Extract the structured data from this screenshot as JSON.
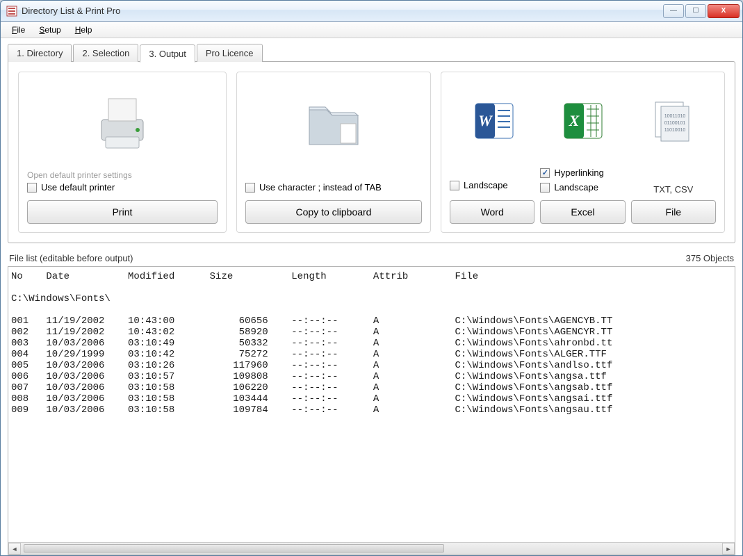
{
  "window": {
    "title": "Directory List & Print Pro"
  },
  "menu": {
    "file": "File",
    "setup": "Setup",
    "help": "Help"
  },
  "tabs": {
    "directory": "1. Directory",
    "selection": "2. Selection",
    "output": "3. Output",
    "licence": "Pro Licence",
    "active": "output"
  },
  "print_panel": {
    "open_settings": "Open default printer settings",
    "use_default": "Use default printer",
    "use_default_checked": false,
    "button": "Print"
  },
  "clipboard_panel": {
    "use_semicolon": "Use character ; instead of TAB",
    "use_semicolon_checked": false,
    "button": "Copy to clipboard"
  },
  "export_panel": {
    "word": {
      "landscape": "Landscape",
      "landscape_checked": false,
      "button": "Word"
    },
    "excel": {
      "hyperlinking": "Hyperlinking",
      "hyperlinking_checked": true,
      "landscape": "Landscape",
      "landscape_checked": false,
      "button": "Excel"
    },
    "file": {
      "formats": "TXT, CSV",
      "button": "File"
    }
  },
  "filelist": {
    "label": "File list (editable before output)",
    "count_label": "375 Objects",
    "headers": {
      "no": "No",
      "date": "Date",
      "modified": "Modified",
      "size": "Size",
      "length": "Length",
      "attrib": "Attrib",
      "file": "File"
    },
    "root": "C:\\Windows\\Fonts\\",
    "rows": [
      {
        "no": "001",
        "date": "11/19/2002",
        "modified": "10:43:00",
        "size": "60656",
        "length": "--:--:--",
        "attrib": "A",
        "file": "C:\\Windows\\Fonts\\AGENCYB.TT"
      },
      {
        "no": "002",
        "date": "11/19/2002",
        "modified": "10:43:02",
        "size": "58920",
        "length": "--:--:--",
        "attrib": "A",
        "file": "C:\\Windows\\Fonts\\AGENCYR.TT"
      },
      {
        "no": "003",
        "date": "10/03/2006",
        "modified": "03:10:49",
        "size": "50332",
        "length": "--:--:--",
        "attrib": "A",
        "file": "C:\\Windows\\Fonts\\ahronbd.tt"
      },
      {
        "no": "004",
        "date": "10/29/1999",
        "modified": "03:10:42",
        "size": "75272",
        "length": "--:--:--",
        "attrib": "A",
        "file": "C:\\Windows\\Fonts\\ALGER.TTF"
      },
      {
        "no": "005",
        "date": "10/03/2006",
        "modified": "03:10:26",
        "size": "117960",
        "length": "--:--:--",
        "attrib": "A",
        "file": "C:\\Windows\\Fonts\\andlso.ttf"
      },
      {
        "no": "006",
        "date": "10/03/2006",
        "modified": "03:10:57",
        "size": "109808",
        "length": "--:--:--",
        "attrib": "A",
        "file": "C:\\Windows\\Fonts\\angsa.ttf"
      },
      {
        "no": "007",
        "date": "10/03/2006",
        "modified": "03:10:58",
        "size": "106220",
        "length": "--:--:--",
        "attrib": "A",
        "file": "C:\\Windows\\Fonts\\angsab.ttf"
      },
      {
        "no": "008",
        "date": "10/03/2006",
        "modified": "03:10:58",
        "size": "103444",
        "length": "--:--:--",
        "attrib": "A",
        "file": "C:\\Windows\\Fonts\\angsai.ttf"
      },
      {
        "no": "009",
        "date": "10/03/2006",
        "modified": "03:10:58",
        "size": "109784",
        "length": "--:--:--",
        "attrib": "A",
        "file": "C:\\Windows\\Fonts\\angsau.ttf"
      }
    ]
  }
}
